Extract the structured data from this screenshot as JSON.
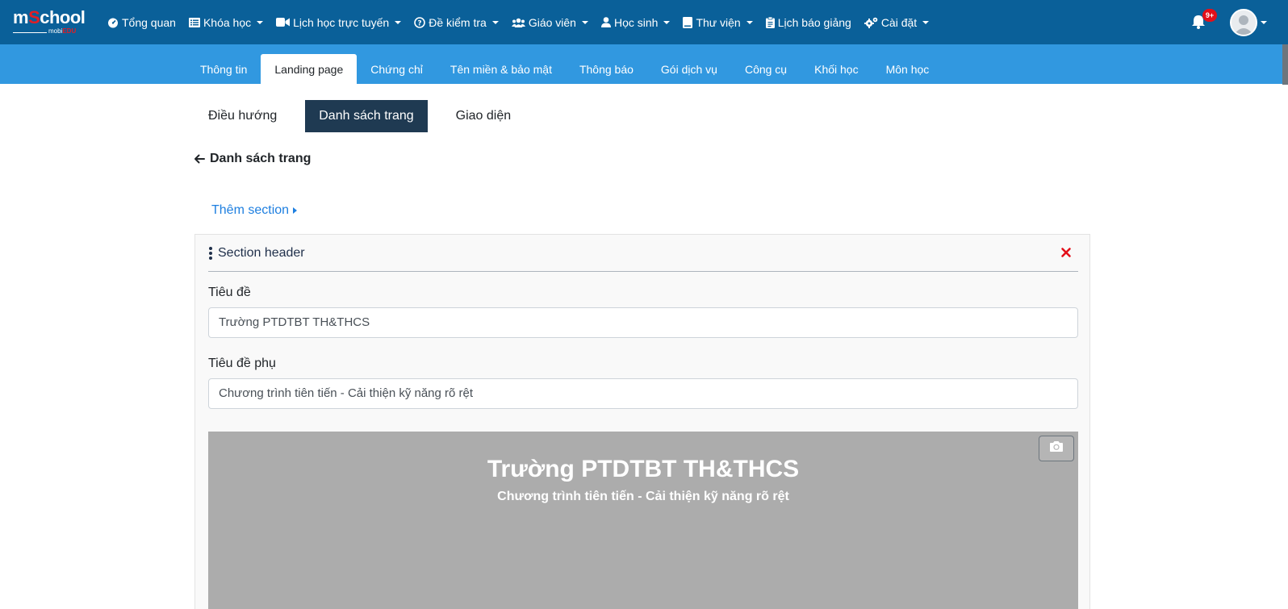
{
  "logo": {
    "brand_pre": "m",
    "brand_s": "S",
    "brand_post": "chool",
    "sub_pre": "mobi",
    "sub_edu": "EDU"
  },
  "nav": {
    "items": [
      {
        "label": "Tổng quan",
        "caret": false
      },
      {
        "label": "Khóa học",
        "caret": true
      },
      {
        "label": "Lịch học trực tuyến",
        "caret": true
      },
      {
        "label": "Đề kiểm tra",
        "caret": true
      },
      {
        "label": "Giáo viên",
        "caret": true
      },
      {
        "label": "Học sinh",
        "caret": true
      },
      {
        "label": "Thư viện",
        "caret": true
      },
      {
        "label": "Lịch báo giảng",
        "caret": false
      },
      {
        "label": "Cài đặt",
        "caret": true
      }
    ],
    "notification_badge": "9+"
  },
  "subtabs": {
    "items": [
      "Thông tin",
      "Landing page",
      "Chứng chỉ",
      "Tên miền & bảo mật",
      "Thông báo",
      "Gói dịch vụ",
      "Công cụ",
      "Khối học",
      "Môn học"
    ],
    "active": "Landing page"
  },
  "page_tabs": {
    "items": [
      "Điều hướng",
      "Danh sách trang",
      "Giao diện"
    ],
    "active": "Danh sách trang"
  },
  "back_link": "Danh sách trang",
  "add_section": "Thêm section",
  "section": {
    "title": "Section header",
    "title_label": "Tiêu đề",
    "title_value": "Trường PTDTBT TH&THCS",
    "subtitle_label": "Tiêu đề phụ",
    "subtitle_value": "Chương trình tiên tiến - Cải thiện kỹ năng rõ rệt",
    "preview_title": "Trường PTDTBT TH&THCS",
    "preview_subtitle": "Chương trình tiên tiến - Cải thiện kỹ năng rõ rệt"
  },
  "colors": {
    "topnav": "#0a6099",
    "subnav": "#3198e0",
    "active_page_tab": "#1f3a52",
    "link": "#1e7fe0",
    "close": "#e3101a",
    "preview_bg": "#acacac"
  }
}
